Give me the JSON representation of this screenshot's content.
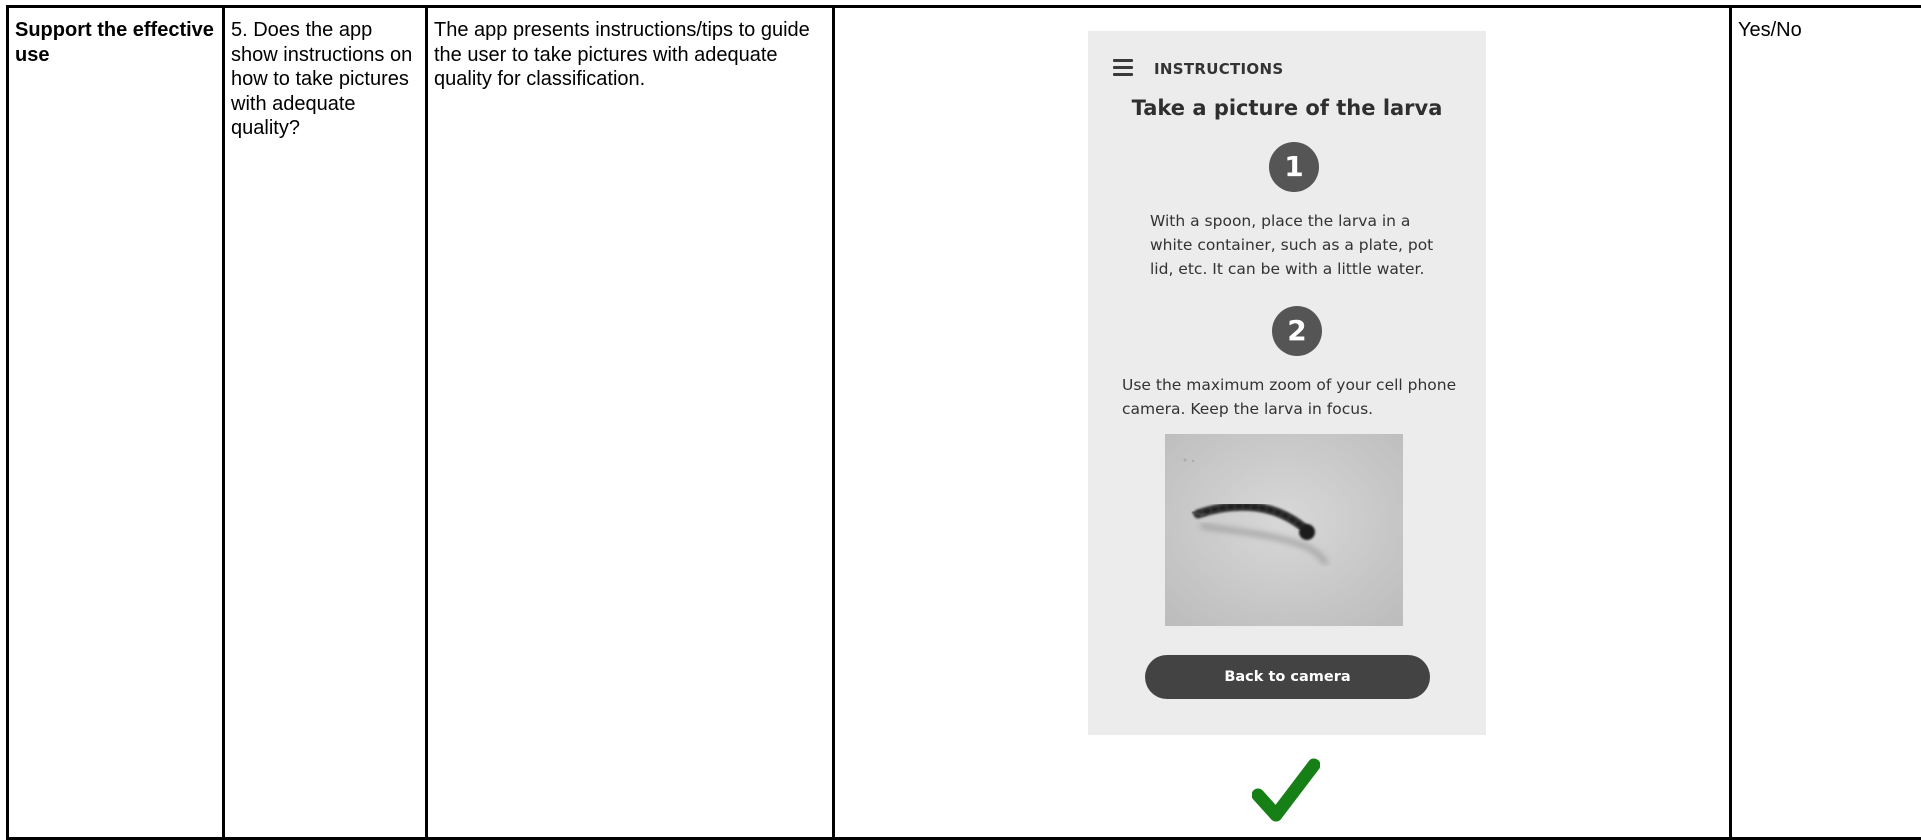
{
  "row": {
    "category": "Support the effective use",
    "question": "5. Does the app show instructions on how to take pictures with adequate quality?",
    "description": "The app presents instructions/tips to guide the user to take pictures with adequate quality for classification.",
    "answer": "Yes/No"
  },
  "app_screen": {
    "menu_icon": "hamburger-menu-icon",
    "app_bar_title": "INSTRUCTIONS",
    "heading": "Take a picture of the larva",
    "steps": [
      {
        "number": "1",
        "text": "With a spoon, place the larva in a white container, such as a plate, pot lid, etc. It can be with a little water."
      },
      {
        "number": "2",
        "text": "Use the maximum zoom of your cell phone camera. Keep the larva in focus."
      }
    ],
    "button_label": "Back to camera",
    "background_color": "#ececec",
    "button_color": "#434343"
  },
  "result": {
    "icon": "check-mark-icon",
    "color": "#168016"
  }
}
